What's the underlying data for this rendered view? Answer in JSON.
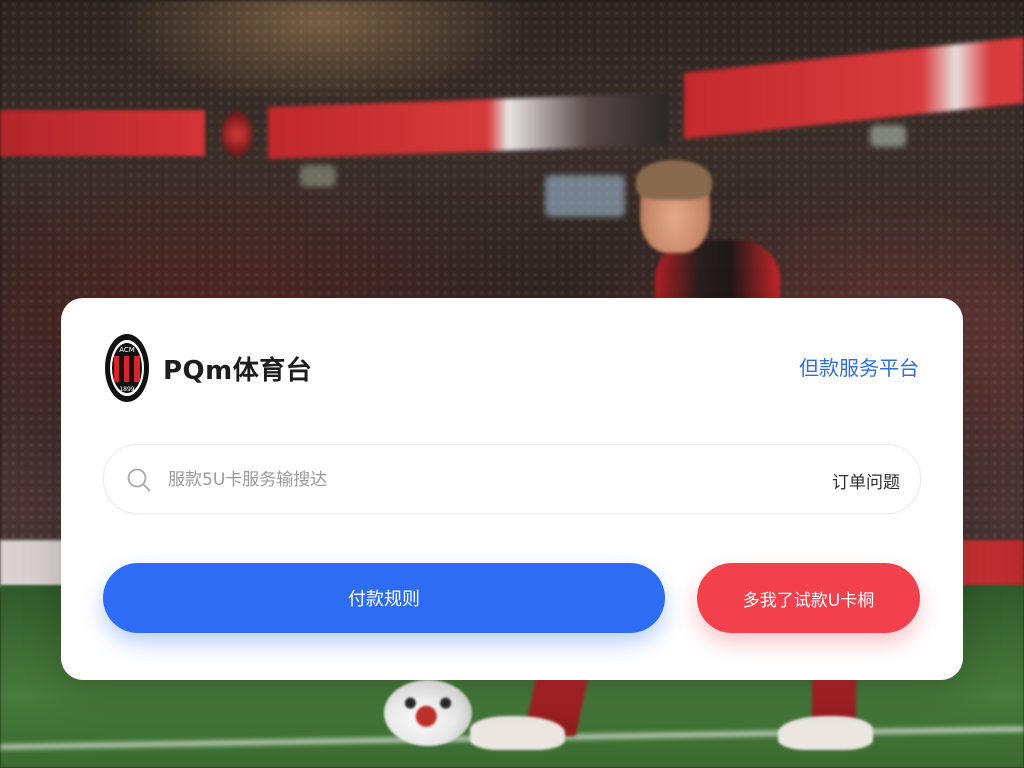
{
  "background": {
    "description_icon": "stadium-photo"
  },
  "card": {
    "logo_icon": "club-crest-icon",
    "title": "PQm体育台",
    "top_link": "但款服务平台",
    "search": {
      "placeholder": "服款5U卡服务输搜达",
      "value": "",
      "hint": "订单问题"
    },
    "primary_button": "付款规则",
    "danger_button": "多我了试款U卡桐"
  },
  "colors": {
    "primary": "#2d6cf3",
    "danger": "#f2414c",
    "link": "#2f6fdc"
  }
}
